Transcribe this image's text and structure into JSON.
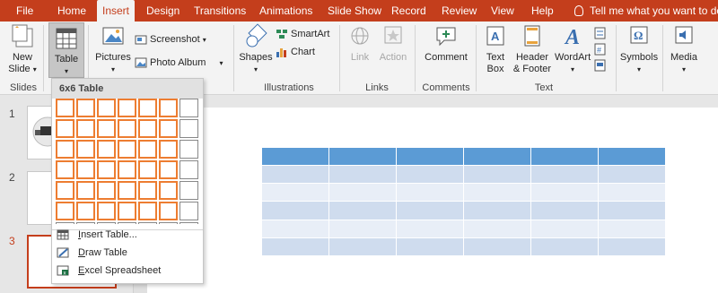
{
  "tabs": [
    {
      "label": "File"
    },
    {
      "label": "Home"
    },
    {
      "label": "Insert",
      "active": true
    },
    {
      "label": "Design"
    },
    {
      "label": "Transitions"
    },
    {
      "label": "Animations"
    },
    {
      "label": "Slide Show"
    },
    {
      "label": "Record"
    },
    {
      "label": "Review"
    },
    {
      "label": "View"
    },
    {
      "label": "Help"
    }
  ],
  "tell_me": "Tell me what you want to do",
  "ribbon": {
    "new_slide_line1": "New",
    "new_slide_line2": "Slide",
    "table": "Table",
    "pictures": "Pictures",
    "screenshot": "Screenshot",
    "photo_album": "Photo Album",
    "shapes": "Shapes",
    "smartart": "SmartArt",
    "chart": "Chart",
    "link": "Link",
    "action": "Action",
    "comment": "Comment",
    "text_box_line1": "Text",
    "text_box_line2": "Box",
    "header_footer_line1": "Header",
    "header_footer_line2": "& Footer",
    "wordart": "WordArt",
    "symbols": "Symbols",
    "media": "Media",
    "groups": {
      "slides": "Slides",
      "illustrations": "Illustrations",
      "links": "Links",
      "comments": "Comments",
      "text": "Text"
    }
  },
  "table_menu": {
    "header": "6x6 Table",
    "rows": 8,
    "cols": 7,
    "selected_rows": 6,
    "selected_cols": 6,
    "insert_table": "Insert Table...",
    "insert_table_key": "I",
    "insert_table_rest": "nsert Table...",
    "draw_table_key": "D",
    "draw_table_rest": "raw Table",
    "excel_key": "E",
    "excel_rest": "xcel Spreadsheet"
  },
  "slides": [
    {
      "number": "1"
    },
    {
      "number": "2"
    },
    {
      "number": "3",
      "active": true
    }
  ],
  "slide_table": {
    "rows": 6,
    "cols": 6
  },
  "colors": {
    "accent": "#c43e1c",
    "grid_selected": "#ed7d31",
    "table_header": "#5b9bd5",
    "table_band1": "#cfdcee",
    "table_band2": "#e8eef7"
  }
}
